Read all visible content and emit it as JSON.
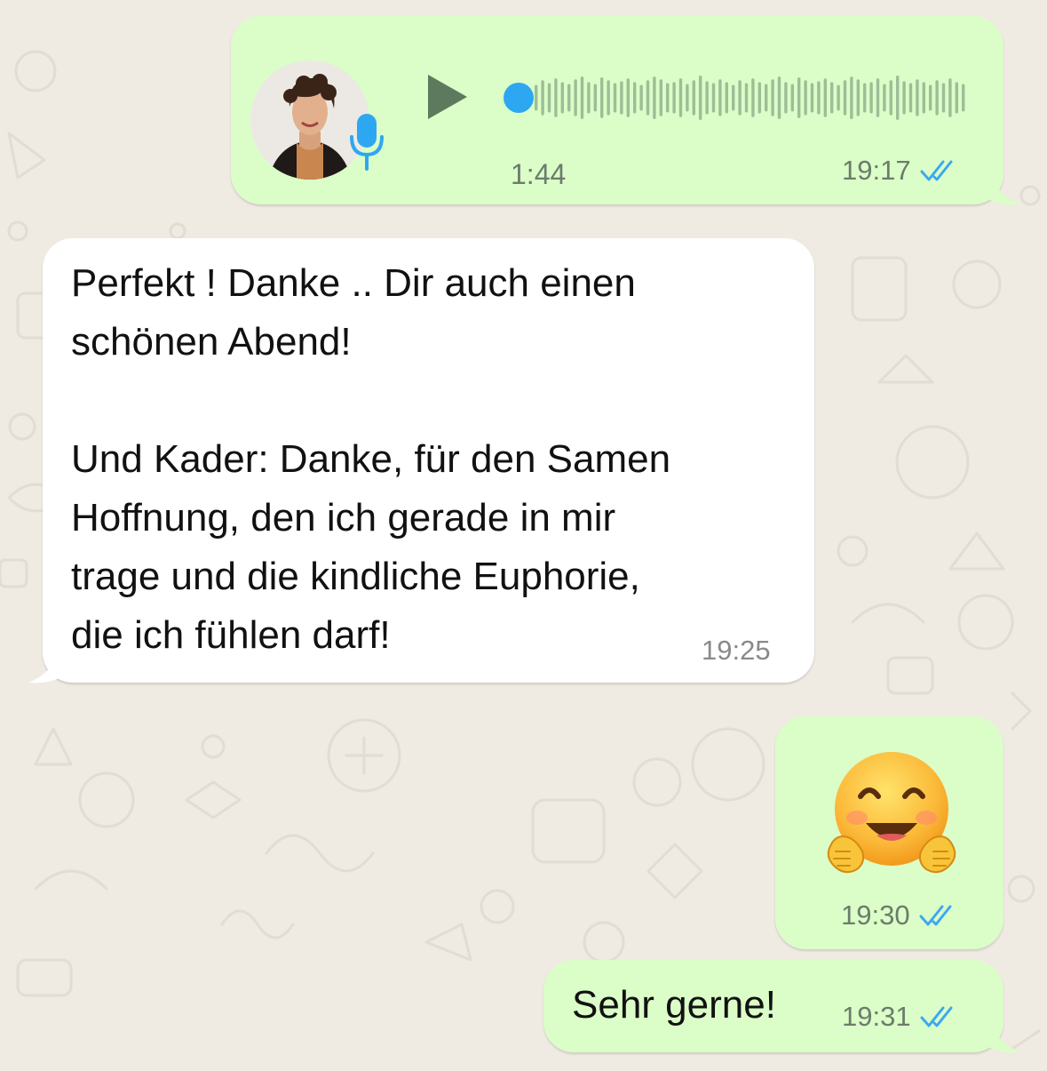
{
  "colors": {
    "outgoing_bubble": "#dbfec8",
    "incoming_bubble": "#ffffff",
    "background": "#efeae2",
    "read_ticks": "#3ca8f0",
    "voice_dot": "#2ea7f2",
    "voice_wave": "#9ebd97"
  },
  "messages": [
    {
      "type": "voice",
      "direction": "outgoing",
      "duration": "1:44",
      "time": "19:17",
      "status_icon": "double-check-read-icon",
      "avatar_icon": "sender-photo",
      "badge_icon": "microphone-icon"
    },
    {
      "type": "text",
      "direction": "incoming",
      "text": "Perfekt ! Danke .. Dir auch einen\nschönen Abend!\n\nUnd Kader: Danke, für den Samen\nHoffnung, den ich gerade in mir\ntrage und die kindliche Euphorie,\ndie ich fühlen darf!",
      "time": "19:25"
    },
    {
      "type": "emoji",
      "direction": "outgoing",
      "emoji_icon": "hugging-face-emoji",
      "time": "19:30",
      "status_icon": "double-check-read-icon"
    },
    {
      "type": "text",
      "direction": "outgoing",
      "text": "Sehr gerne!",
      "time": "19:31",
      "status_icon": "double-check-read-icon"
    }
  ]
}
